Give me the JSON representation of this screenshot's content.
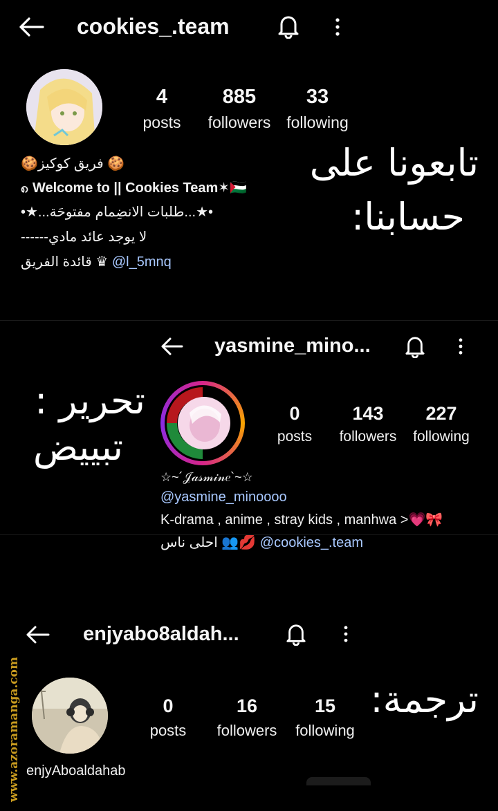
{
  "profiles": [
    {
      "username": "cookies_.team",
      "posts": "4",
      "posts_label": "posts",
      "followers": "885",
      "followers_label": "followers",
      "following": "33",
      "following_label": "following",
      "bio": {
        "line1": "🍪 فريق كوكيز🍪",
        "line2": "၈ Welcome to || Cookies Team✶🇵🇸",
        "line3": "•★...طلبات الانضِمام مفتوحَة...★•",
        "line4": "لا يوجد عائد مادي------",
        "line5_mention": "@l_5mnq",
        "line5_text": "♛ قائدة الفريق"
      }
    },
    {
      "username": "yasmine_mino...",
      "posts": "0",
      "posts_label": "posts",
      "followers": "143",
      "followers_label": "followers",
      "following": "227",
      "following_label": "following",
      "display_name": "☆~´𝒥𝒶𝓈𝓂𝒾𝓃𝑒`~☆",
      "handle": "@yasmine_minoooo",
      "bio_line": "K-drama , anime , stray kids , manhwa >💗🎀",
      "bio_mention": "@cookies_.team",
      "bio_tail": "💋👥 احلى ناس"
    },
    {
      "username": "enjyabo8aldah...",
      "posts": "0",
      "posts_label": "posts",
      "followers": "16",
      "followers_label": "followers",
      "following": "15",
      "following_label": "following",
      "display_name": "enjyAboaldahab"
    }
  ],
  "overlay": {
    "follow_us_1": "تابعونا على",
    "follow_us_2": "حسابنا:",
    "editing_1": "تحرير :",
    "editing_2": "تبييض",
    "translation": "ترجمة:"
  },
  "watermark": "www.azoramanga.com",
  "colors": {
    "background": "#000000",
    "mention": "#a8c8ff",
    "watermark": "#c79a1f"
  }
}
